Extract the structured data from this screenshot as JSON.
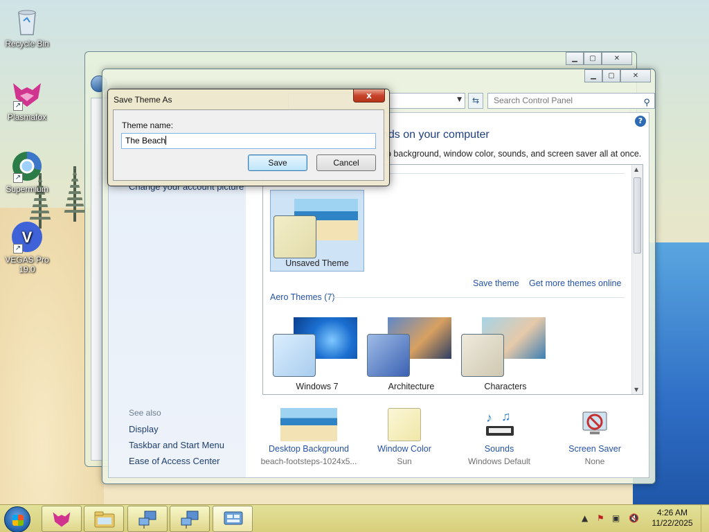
{
  "desktop": {
    "icons": [
      {
        "label": "Recycle Bin"
      },
      {
        "label": "Plasmafox"
      },
      {
        "label": "Supermium"
      },
      {
        "label": "VEGAS Pro 19.0"
      }
    ]
  },
  "window": {
    "search_placeholder": "Search Control Panel",
    "title_heading": "nds on your computer",
    "subtitle": "p background, window color, sounds, and screen saver all at once.",
    "left_links": {
      "account_picture": "Change your account picture"
    },
    "see_also": {
      "label": "See also",
      "items": [
        "Display",
        "Taskbar and Start Menu",
        "Ease of Access Center"
      ]
    },
    "my_themes": {
      "unsaved_label": "Unsaved Theme",
      "save_theme_link": "Save theme",
      "more_themes_link": "Get more themes online"
    },
    "aero_group": {
      "label": "Aero Themes (7)",
      "themes": [
        "Windows 7",
        "Architecture",
        "Characters"
      ]
    },
    "bottom_bar": [
      {
        "label": "Desktop Background",
        "value": "beach-footsteps-1024x5..."
      },
      {
        "label": "Window Color",
        "value": "Sun"
      },
      {
        "label": "Sounds",
        "value": "Windows Default"
      },
      {
        "label": "Screen Saver",
        "value": "None"
      }
    ]
  },
  "dialog": {
    "title": "Save Theme As",
    "close_glyph": "x",
    "field_label": "Theme name:",
    "field_value": "The Beach",
    "save_label": "Save",
    "cancel_label": "Cancel"
  },
  "taskbar": {
    "clock_time": "4:26 AM",
    "clock_date": "11/22/2025"
  },
  "colors": {
    "accent_link": "#2452a6",
    "title_blue": "#1e3f80",
    "close_red": "#c7432a"
  }
}
